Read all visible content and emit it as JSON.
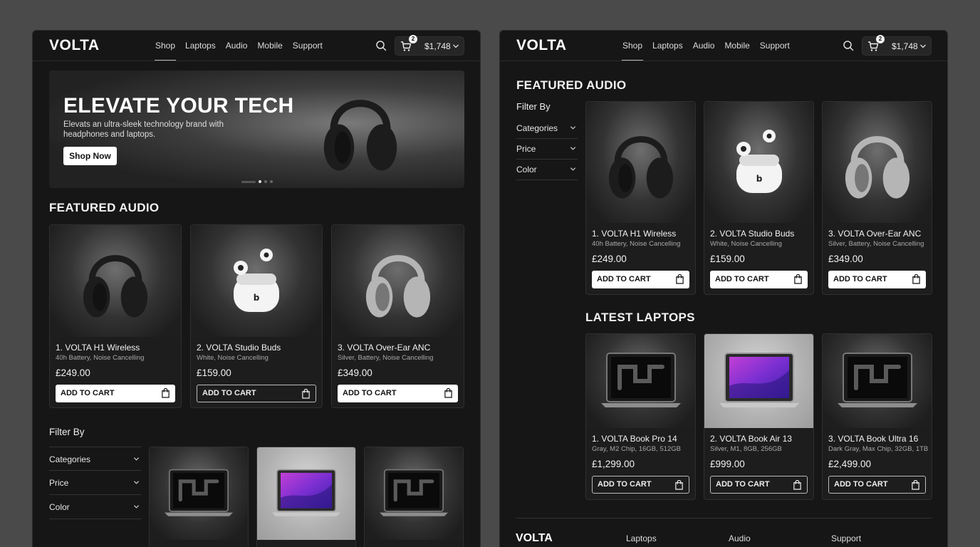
{
  "brand": "VOLTA",
  "nav": [
    "Shop",
    "Laptops",
    "Audio",
    "Mobile",
    "Support"
  ],
  "cart": {
    "count": "2",
    "total": "$1,748"
  },
  "hero": {
    "title": "ELEVATE YOUR TECH",
    "subtitle": "Elevats an ultra-sleek technology brand with headphones and laptops.",
    "button": "Shop Now",
    "slide_count": 4,
    "active_slide": 1
  },
  "featured_audio": {
    "title": "FEATURED AUDIO",
    "products": [
      {
        "name": "1. VOLTA H1 Wireless",
        "desc": "40h Battery, Noise Cancelling",
        "price": "£249.00",
        "button": "ADD TO CART",
        "image": "black-headphones"
      },
      {
        "name": "2. VOLTA Studio Buds",
        "desc": "White, Noise Cancelling",
        "price": "£159.00",
        "button": "ADD TO CART",
        "image": "white-earbuds"
      },
      {
        "name": "3. VOLTA Over-Ear ANC",
        "desc": "Silver, Battery, Noise Cancelling",
        "price": "£349.00",
        "button": "ADD TO CART",
        "image": "silver-headphones"
      }
    ]
  },
  "filter": {
    "title": "Filter By",
    "items": [
      "Categories",
      "Price",
      "Color"
    ]
  },
  "latest_laptops": {
    "title": "LATEST LAPTOPS",
    "products": [
      {
        "name": "1. VOLTA Book Pro 14",
        "desc": "Gray, M2 Chip, 16GB, 512GB",
        "price": "£1,299.00",
        "button": "ADD TO CART",
        "image": "dark-laptop"
      },
      {
        "name": "2. VOLTA Book Air 13",
        "desc": "Silver, M1, 8GB, 256GB",
        "price": "£999.00",
        "button": "ADD TO CART",
        "image": "silver-laptop"
      },
      {
        "name": "3. VOLTA Book Ultra 16",
        "desc": "Dark Gray, Max Chip, 32GB, 1TB",
        "price": "£2,499.00",
        "button": "ADD TO CART",
        "image": "dark-laptop"
      }
    ]
  },
  "footer": {
    "brand": "VOLTA",
    "links": [
      "Laptops",
      "Audio",
      "Support"
    ]
  },
  "colors": {
    "page_bg": "#4a4a4a",
    "panel_bg": "#161616",
    "card_bg": "#1d1d1d",
    "accent_white": "#ffffff"
  }
}
